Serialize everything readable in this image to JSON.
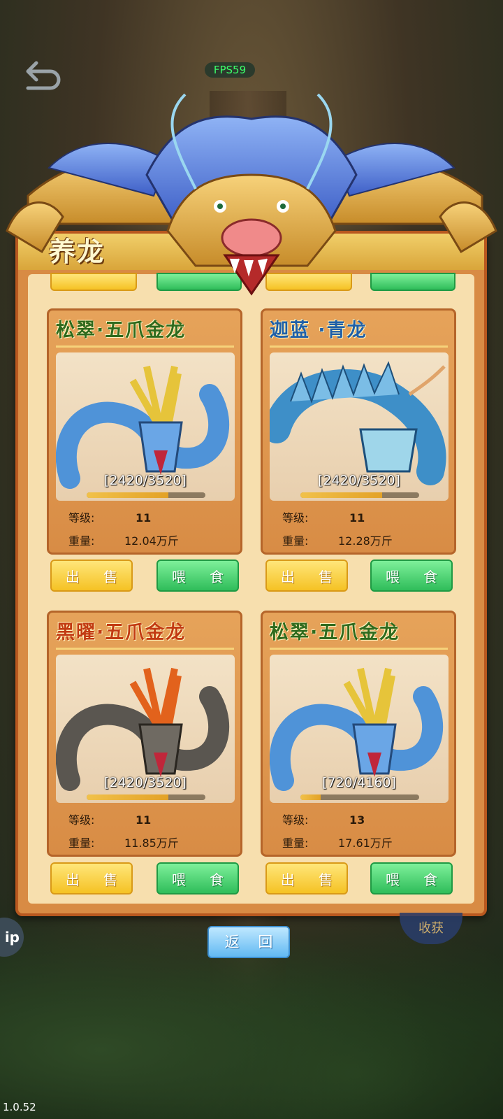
{
  "hud": {
    "fps": "FPS59",
    "version": "1.0.52",
    "back_icon": "back-arrow-icon",
    "left_badge": "ip",
    "right_badge": "收获"
  },
  "panel": {
    "title": "养龙",
    "colors": {
      "frame": "#d88b44",
      "border": "#b8581f",
      "inner": "#f7dfae"
    }
  },
  "labels": {
    "level": "等级:",
    "weight": "重量:",
    "sell": "出 售",
    "feed": "喂 食",
    "return": "返 回"
  },
  "dragons": [
    {
      "name": "松翠·五爪金龙",
      "name_color": "#2f6a1d",
      "exp": "[2420/3520]",
      "exp_current": 2420,
      "exp_max": 3520,
      "level": "11",
      "weight": "12.04万斤",
      "palette": [
        "#4f93d8",
        "#e6c43a"
      ]
    },
    {
      "name": "迦蓝 ·青龙",
      "name_color": "#1f5fa8",
      "exp": "[2420/3520]",
      "exp_current": 2420,
      "exp_max": 3520,
      "level": "11",
      "weight": "12.28万斤",
      "palette": [
        "#3e8fc8",
        "#9fd6ea"
      ]
    },
    {
      "name": "黑曜·五爪金龙",
      "name_color": "#c23a12",
      "exp": "[2420/3520]",
      "exp_current": 2420,
      "exp_max": 3520,
      "level": "11",
      "weight": "11.85万斤",
      "palette": [
        "#5a5650",
        "#e2621c"
      ]
    },
    {
      "name": "松翠·五爪金龙",
      "name_color": "#2f6a1d",
      "exp": "[720/4160]",
      "exp_current": 720,
      "exp_max": 4160,
      "level": "13",
      "weight": "17.61万斤",
      "palette": [
        "#4f93d8",
        "#e6c43a"
      ]
    }
  ]
}
